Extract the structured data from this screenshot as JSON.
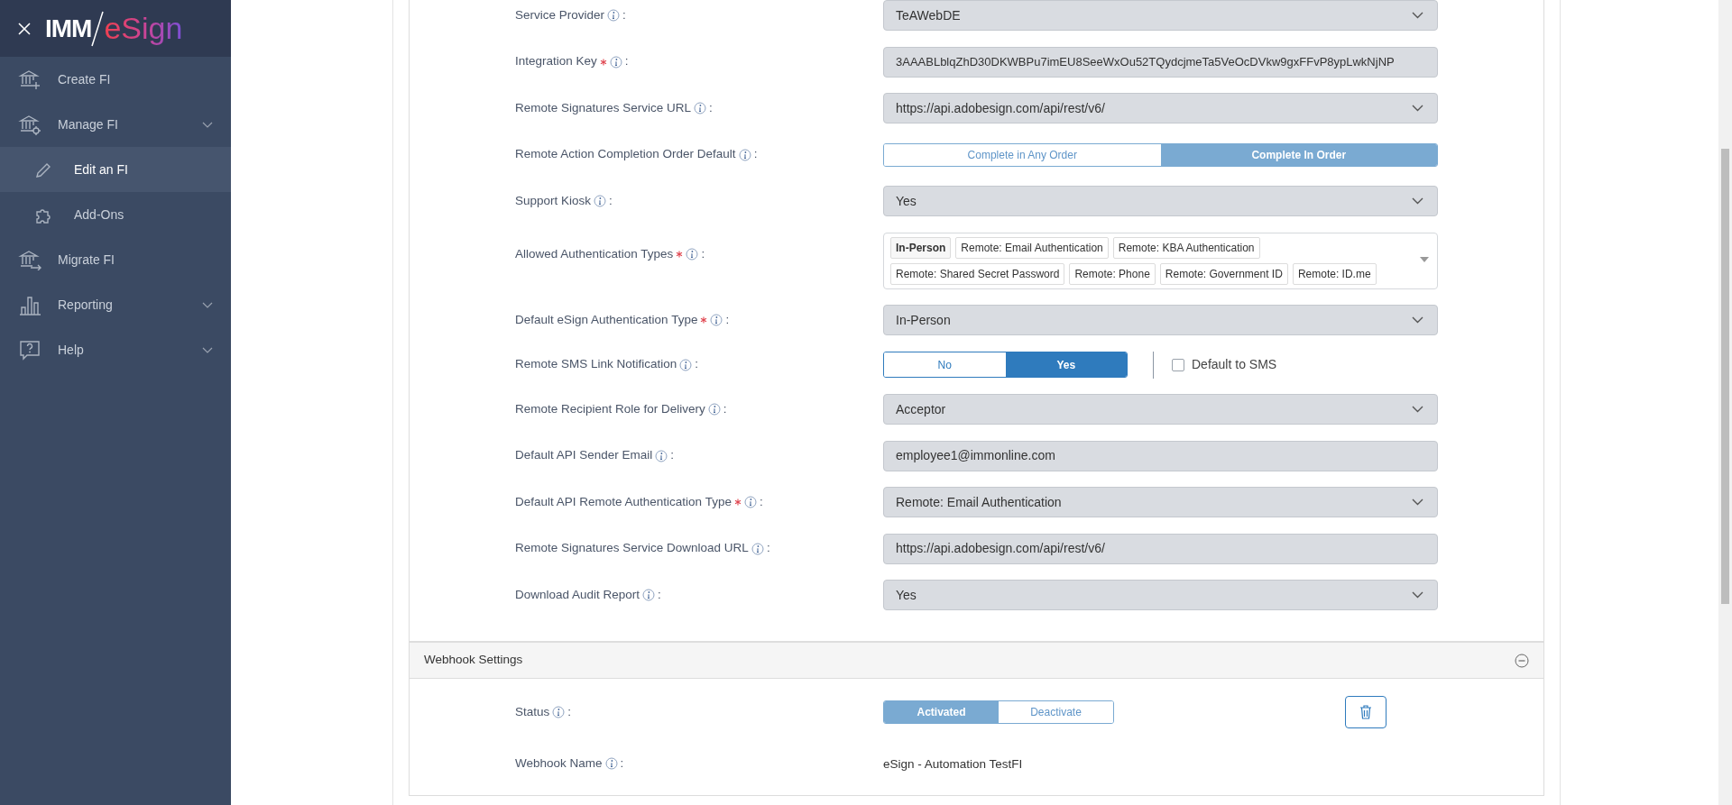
{
  "sidebar": {
    "logo": {
      "prefix": "IMM",
      "suffix": "eSign"
    },
    "items": [
      {
        "label": "Create FI",
        "kind": "link",
        "selected": false
      },
      {
        "label": "Manage FI",
        "kind": "group",
        "selected": false,
        "children": [
          {
            "label": "Edit an FI",
            "selected": true
          },
          {
            "label": "Add-Ons",
            "selected": false
          }
        ]
      },
      {
        "label": "Migrate FI",
        "kind": "link",
        "selected": false
      },
      {
        "label": "Reporting",
        "kind": "group",
        "selected": false
      },
      {
        "label": "Help",
        "kind": "group",
        "selected": false
      }
    ]
  },
  "form": {
    "fields": [
      {
        "label": "Service Provider",
        "required": false,
        "colon": ":",
        "kind": "select",
        "value": "TeAWebDE"
      },
      {
        "label": "Integration Key",
        "required": true,
        "colon": ":",
        "kind": "input",
        "value": "3AAABLblqZhD30DKWBPu7imEU8SeeWxOu52TQydcjmeTa5VeOcDVkw9gxFFvP8ypLwkNjNP"
      },
      {
        "label": "Remote Signatures Service URL",
        "required": false,
        "colon": ":",
        "kind": "select",
        "value": "https://api.adobesign.com/api/rest/v6/"
      },
      {
        "label": "Remote Action Completion Order Default",
        "required": false,
        "colon": ":",
        "kind": "segmented",
        "options": [
          {
            "label": "Complete in Any Order",
            "selected": false
          },
          {
            "label": "Complete In Order",
            "selected": true
          }
        ]
      },
      {
        "label": "Support Kiosk",
        "required": false,
        "colon": ":",
        "kind": "select",
        "value": "Yes"
      },
      {
        "label": "Allowed Authentication Types",
        "required": true,
        "colon": ":",
        "kind": "tags",
        "tags": [
          {
            "label": "In-Person",
            "selected": true
          },
          {
            "label": "Remote: Email Authentication",
            "selected": false
          },
          {
            "label": "Remote: KBA Authentication",
            "selected": false
          },
          {
            "label": "Remote: Shared Secret Password",
            "selected": false
          },
          {
            "label": "Remote: Phone",
            "selected": false
          },
          {
            "label": "Remote: Government ID",
            "selected": false
          },
          {
            "label": "Remote: ID.me",
            "selected": false
          }
        ]
      },
      {
        "label": "Default eSign Authentication Type",
        "required": true,
        "colon": ":",
        "kind": "select",
        "value": "In-Person"
      },
      {
        "label": "Remote SMS Link Notification",
        "required": false,
        "colon": ":",
        "kind": "switch",
        "options": [
          {
            "label": "No",
            "selected": false
          },
          {
            "label": "Yes",
            "selected": true
          }
        ],
        "checkbox": {
          "label": "Default to SMS",
          "checked": false
        }
      },
      {
        "label": "Remote Recipient Role for Delivery",
        "required": false,
        "colon": ":",
        "kind": "select",
        "value": "Acceptor"
      },
      {
        "label": "Default API Sender Email",
        "required": false,
        "colon": ":",
        "kind": "input",
        "value": "employee1@immonline.com"
      },
      {
        "label": "Default API Remote Authentication Type",
        "required": true,
        "colon": ":",
        "kind": "select",
        "value": "Remote: Email Authentication"
      },
      {
        "label": "Remote Signatures Service Download URL",
        "required": false,
        "colon": ":",
        "kind": "input",
        "value": "https://api.adobesign.com/api/rest/v6/"
      },
      {
        "label": "Download Audit Report",
        "required": false,
        "colon": ":",
        "kind": "select",
        "value": "Yes"
      }
    ]
  },
  "webhook": {
    "title": "Webhook Settings",
    "expanded": true,
    "fields": [
      {
        "label": "Status",
        "colon": ":",
        "kind": "segmented",
        "options": [
          {
            "label": "Activated",
            "selected": true
          },
          {
            "label": "Deactivate",
            "selected": false
          }
        ],
        "deletable": true
      },
      {
        "label": "Webhook Name",
        "colon": ":",
        "kind": "text",
        "value": "eSign - Automation TestFI"
      }
    ]
  }
}
